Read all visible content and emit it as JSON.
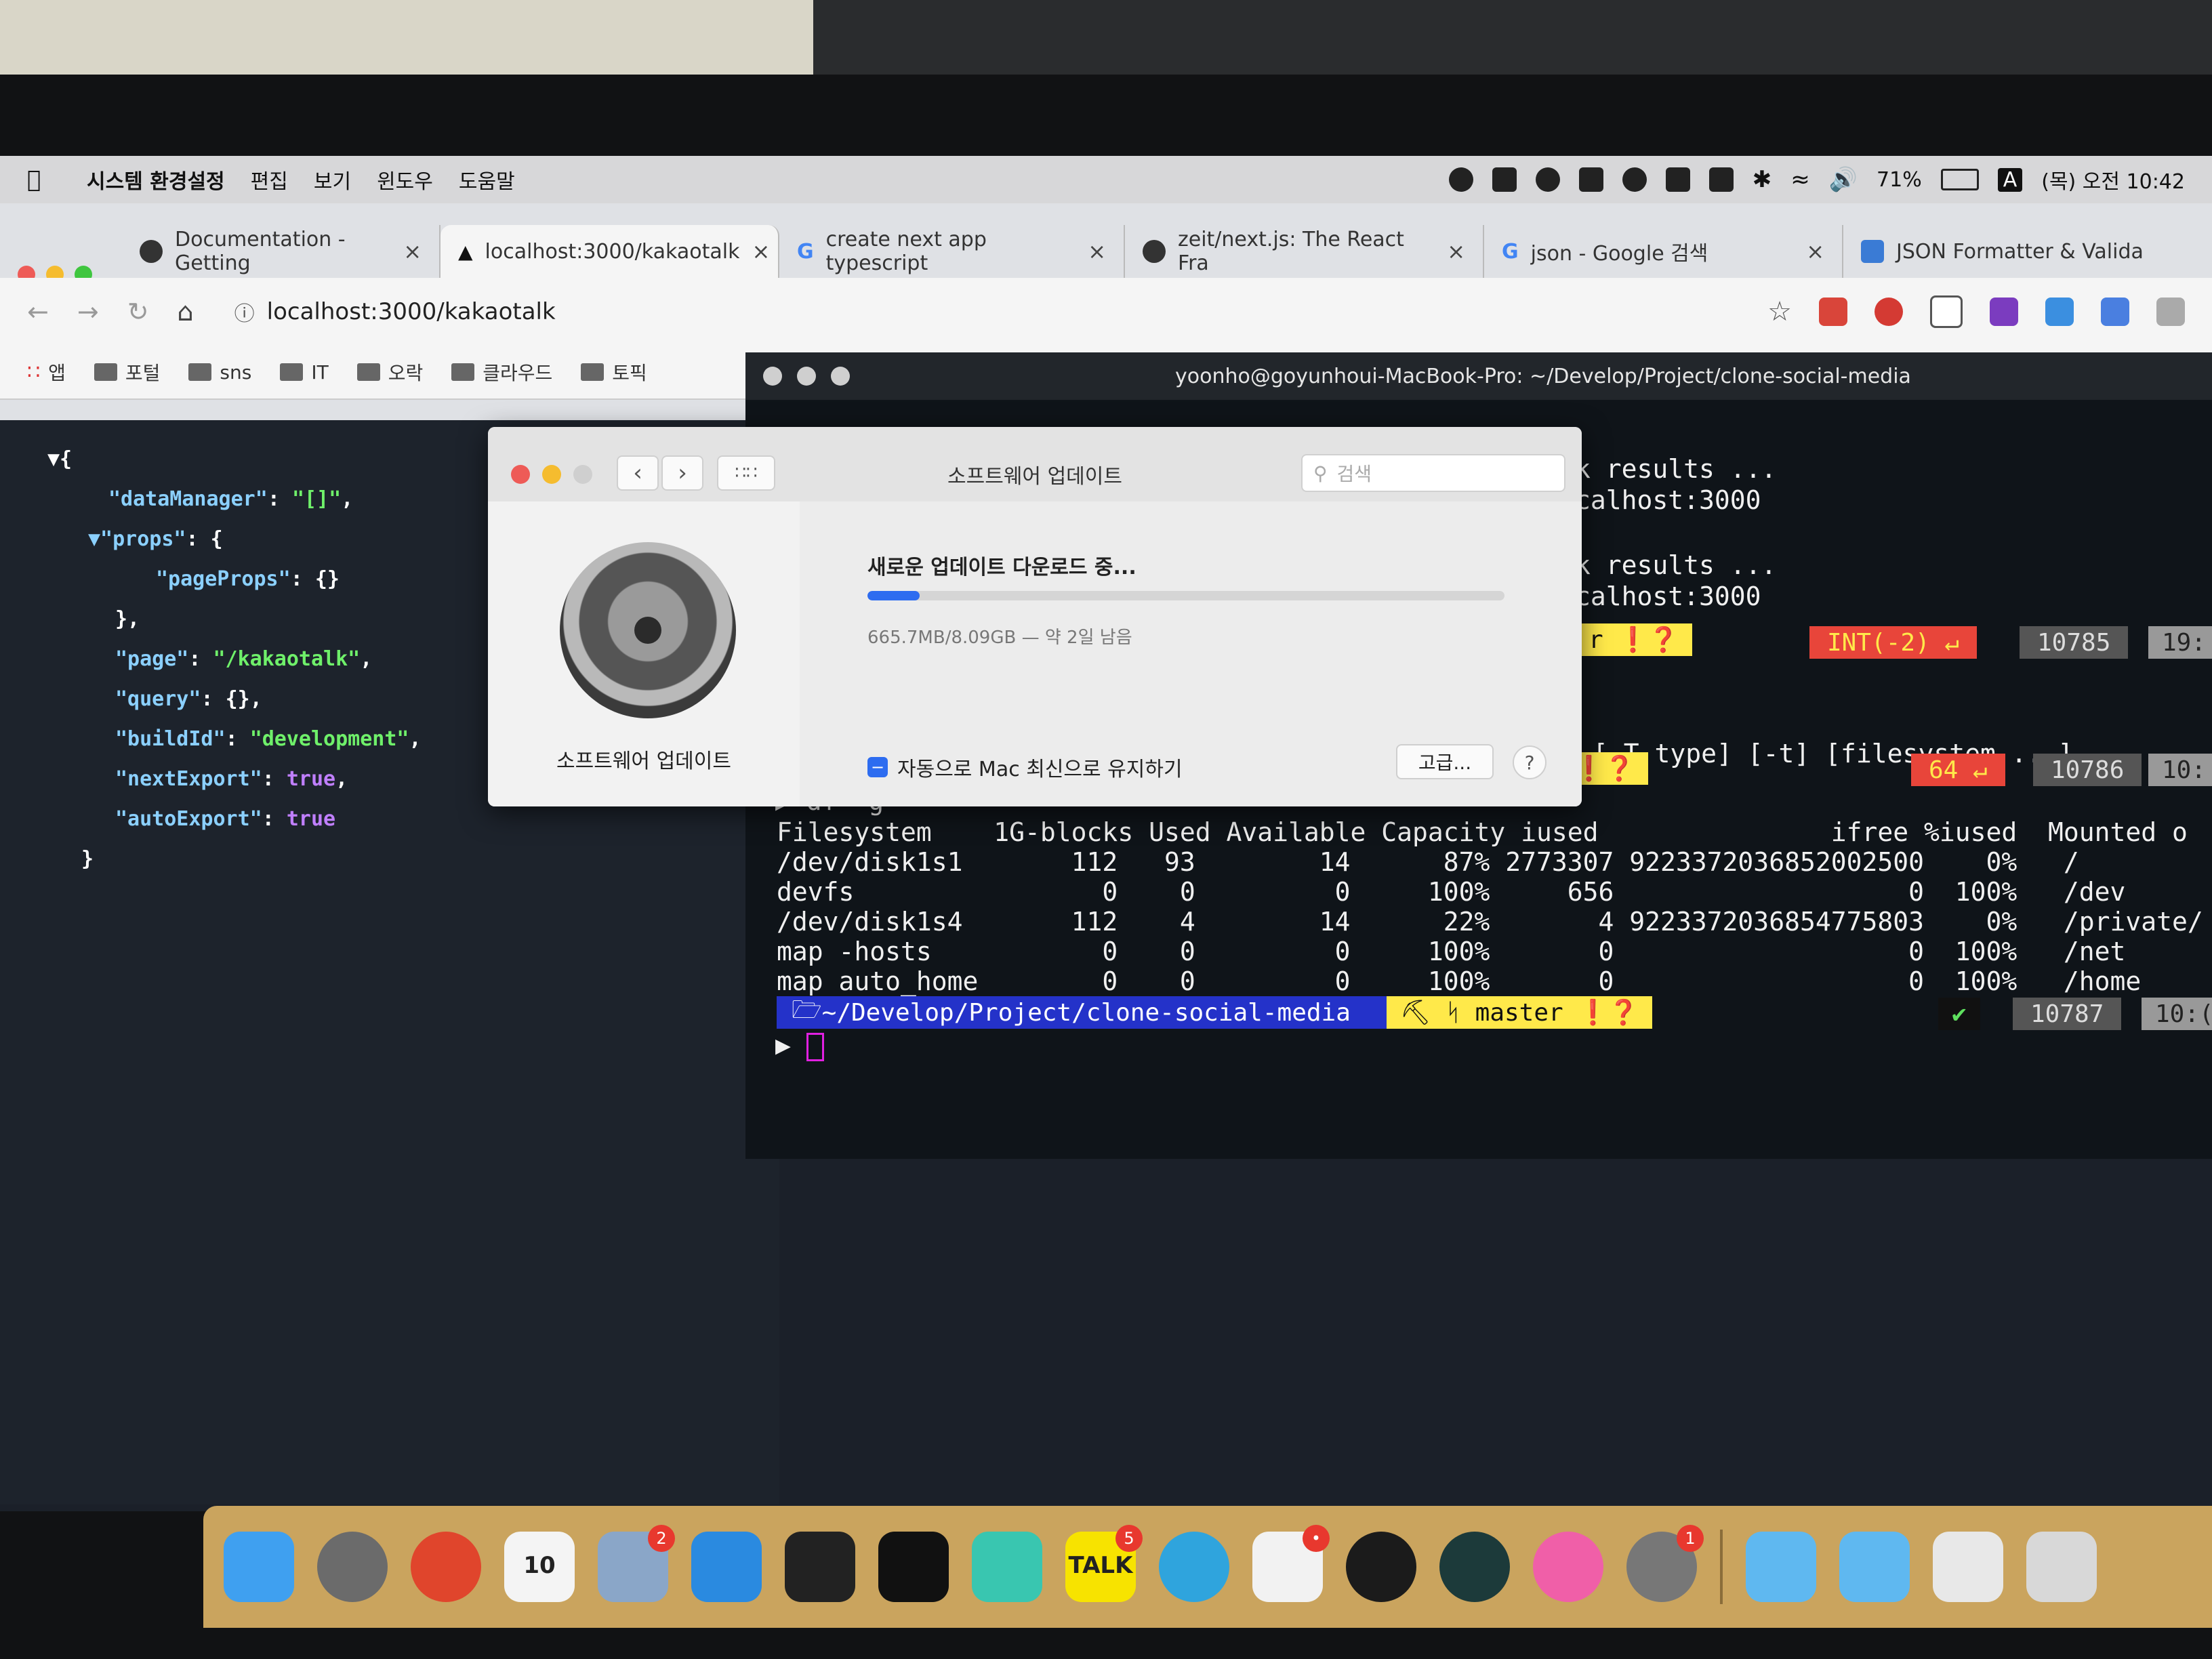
{
  "menubar": {
    "app_name": "시스템 환경설정",
    "items": [
      "편집",
      "보기",
      "윈도우",
      "도움말"
    ],
    "battery": "71%",
    "input_source": "A",
    "clock": "(목) 오전 10:42"
  },
  "browser": {
    "tabs": [
      {
        "title": "Documentation - Getting",
        "active": false
      },
      {
        "title": "localhost:3000/kakaotalk",
        "active": true
      },
      {
        "title": "create next app typescript",
        "active": false
      },
      {
        "title": "zeit/next.js: The React Fra",
        "active": false
      },
      {
        "title": "json - Google 검색",
        "active": false
      },
      {
        "title": "JSON Formatter & Valida",
        "active": false
      }
    ],
    "address": "localhost:3000/kakaotalk",
    "bookmarks": [
      "앱",
      "포털",
      "sns",
      "IT",
      "오락",
      "클라우드",
      "토픽"
    ]
  },
  "json_view": {
    "lines": [
      {
        "t": "▼{"
      },
      {
        "k": "\"dataManager\"",
        "v": "\"[]\"",
        "vt": "s",
        "tail": ","
      },
      {
        "k": "▼\"props\"",
        "v": "{",
        "vt": "p",
        "tail": ""
      },
      {
        "k": "\"pageProps\"",
        "v": "{}",
        "vt": "p",
        "tail": ""
      },
      {
        "t": "},"
      },
      {
        "k": "\"page\"",
        "v": "\"/kakaotalk\"",
        "vt": "s",
        "tail": ","
      },
      {
        "k": "\"query\"",
        "v": "{}",
        "vt": "p",
        "tail": ","
      },
      {
        "k": "\"buildId\"",
        "v": "\"development\"",
        "vt": "s",
        "tail": ","
      },
      {
        "k": "\"nextExport\"",
        "v": "true",
        "vt": "b",
        "tail": ","
      },
      {
        "k": "\"autoExport\"",
        "v": "true",
        "vt": "b",
        "tail": ""
      },
      {
        "t": "}"
      }
    ]
  },
  "terminal": {
    "title": "yoonho@goyunhoui-MacBook-Pro: ~/Develop/Project/clone-social-media",
    "partial_lines": [
      "k results ...",
      "calhost:3000",
      "k results ...",
      "calhost:3000",
      "[-T type] [-t] [filesystem ...]"
    ],
    "prompt_path": "~/Develop/Project/clone-social-media",
    "branch": "master",
    "status_int": "INT(-2) ↵",
    "status_64": "64 ↵",
    "hist": [
      "10785",
      "10786",
      "10787"
    ],
    "time_partials": [
      "19:",
      "10:",
      "10:("
    ],
    "command": "df -g",
    "df_header": "Filesystem    1G-blocks Used Available Capacity iused               ifree %iused  Mounted o",
    "df_rows": [
      "/dev/disk1s1       112   93        14      87% 2773307 9223372036852002500    0%   /",
      "devfs                0    0         0     100%     656                   0  100%   /dev",
      "/dev/disk1s4       112    4        14      22%       4 9223372036854775803    0%   /private/",
      "map -hosts           0    0         0     100%       0                   0  100%   /net",
      "map auto_home        0    0         0     100%       0                   0  100%   /home"
    ]
  },
  "update_dialog": {
    "title": "소프트웨어 업데이트",
    "search_placeholder": "검색",
    "sidebar_label": "소프트웨어 업데이트",
    "status": "새로운 업데이트 다운로드 중...",
    "progress": 0.082,
    "size_text": "665.7MB/8.09GB — 약 2일 남음",
    "auto_update_label": "자동으로 Mac 최신으로 유지하기",
    "advanced_button": "고급...",
    "help_button": "?"
  },
  "dock": {
    "apps": [
      {
        "name": "finder",
        "color": "#3fa0f0"
      },
      {
        "name": "launchpad",
        "color": "#6b6b6b"
      },
      {
        "name": "chrome",
        "color": "#e0452c"
      },
      {
        "name": "calendar",
        "color": "#f4f4f4",
        "label": "10"
      },
      {
        "name": "preview",
        "color": "#8aa6c8",
        "badge": "2"
      },
      {
        "name": "vscode",
        "color": "#2a8ae0"
      },
      {
        "name": "terminal",
        "color": "#222222"
      },
      {
        "name": "hyper",
        "color": "#111111"
      },
      {
        "name": "app-store-star",
        "color": "#39c6b0"
      },
      {
        "name": "kakaotalk",
        "color": "#f7e300",
        "label": "TALK",
        "badge": "5"
      },
      {
        "name": "telegram",
        "color": "#2fa4dd"
      },
      {
        "name": "slack",
        "color": "#f2f2f2",
        "badge": "•"
      },
      {
        "name": "youtube",
        "color": "#1b1b1b"
      },
      {
        "name": "gitkraken",
        "color": "#1c3a3a"
      },
      {
        "name": "music",
        "color": "#f05fa8"
      },
      {
        "name": "system-preferences",
        "color": "#777777",
        "badge": "1"
      },
      {
        "name": "folder",
        "color": "#5fb8f0"
      },
      {
        "name": "downloads-folder",
        "color": "#5fb8f0"
      },
      {
        "name": "document",
        "color": "#e8e8e8"
      },
      {
        "name": "trash",
        "color": "#d8d8d8"
      }
    ]
  }
}
